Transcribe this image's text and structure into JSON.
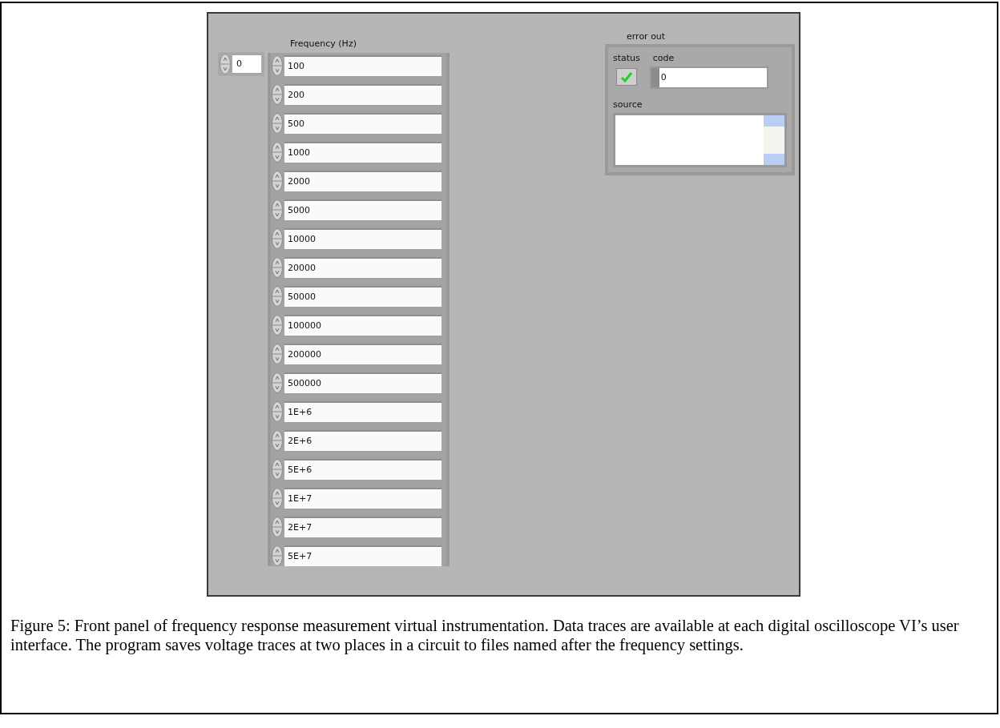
{
  "panel": {
    "index_control": {
      "value": "0"
    },
    "frequency_array": {
      "label": "Frequency (Hz)",
      "values": [
        "100",
        "200",
        "500",
        "1000",
        "2000",
        "5000",
        "10000",
        "20000",
        "50000",
        "100000",
        "200000",
        "500000",
        "1E+6",
        "2E+6",
        "5E+6",
        "1E+7",
        "2E+7",
        "5E+7"
      ]
    },
    "error_out": {
      "label": "error out",
      "status": {
        "label": "status",
        "ok": true
      },
      "code": {
        "label": "code",
        "value": "0"
      },
      "source": {
        "label": "source"
      }
    }
  },
  "caption": "Figure 5: Front panel of frequency response measurement virtual instrumentation. Data traces are available at each digital oscilloscope VI’s user interface.  The program saves voltage traces at two places in a circuit to files named after the frequency settings."
}
